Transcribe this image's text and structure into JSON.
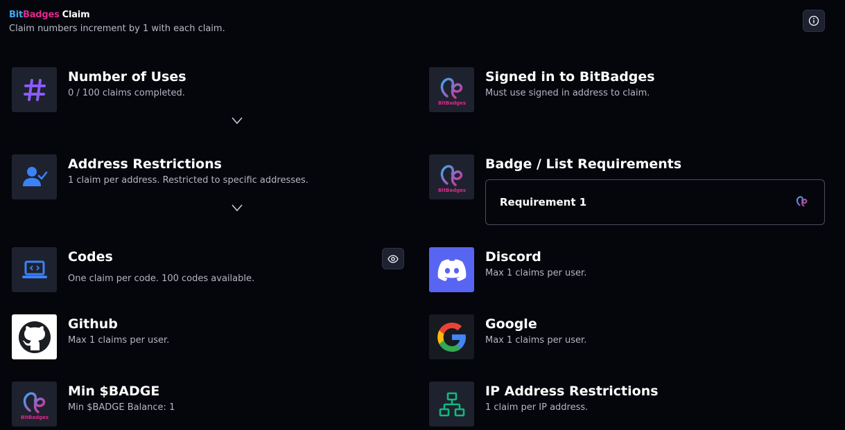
{
  "header": {
    "brand_bit": "Bit",
    "brand_badges": "Badges",
    "brand_claim": "Claim",
    "subtitle": "Claim numbers increment by 1 with each claim."
  },
  "icons": {
    "info": "info-icon",
    "eye": "eye-icon",
    "chevron": "chevron-down-icon"
  },
  "colors": {
    "background": "#05060c",
    "icon_box": "#1e222e",
    "hash_purple": "#8b5cf6",
    "user_blue": "#3b82f6",
    "discord": "#5865f2",
    "network_green": "#10b981",
    "bitbadges_blue": "#3fa9f5",
    "bitbadges_pink": "#e0288c"
  },
  "plugins": {
    "uses": {
      "title": "Number of Uses",
      "desc": "0 / 100 claims completed."
    },
    "signed_in": {
      "title": "Signed in to BitBadges",
      "desc": "Must use signed in address to claim."
    },
    "address": {
      "title": "Address Restrictions",
      "desc": "1 claim per address. Restricted to specific addresses."
    },
    "badge_list": {
      "title": "Badge / List Requirements",
      "requirement": "Requirement 1"
    },
    "codes": {
      "title": "Codes",
      "desc": "One claim per code. 100 codes available."
    },
    "discord": {
      "title": "Discord",
      "desc": "Max 1 claims per user."
    },
    "github": {
      "title": "Github",
      "desc": "Max 1 claims per user."
    },
    "google": {
      "title": "Google",
      "desc": "Max 1 claims per user."
    },
    "min_badge": {
      "title": "Min $BADGE",
      "desc": "Min $BADGE Balance: 1"
    },
    "ip": {
      "title": "IP Address Restrictions",
      "desc": "1 claim per IP address."
    }
  },
  "logo_text": "BitBadges"
}
